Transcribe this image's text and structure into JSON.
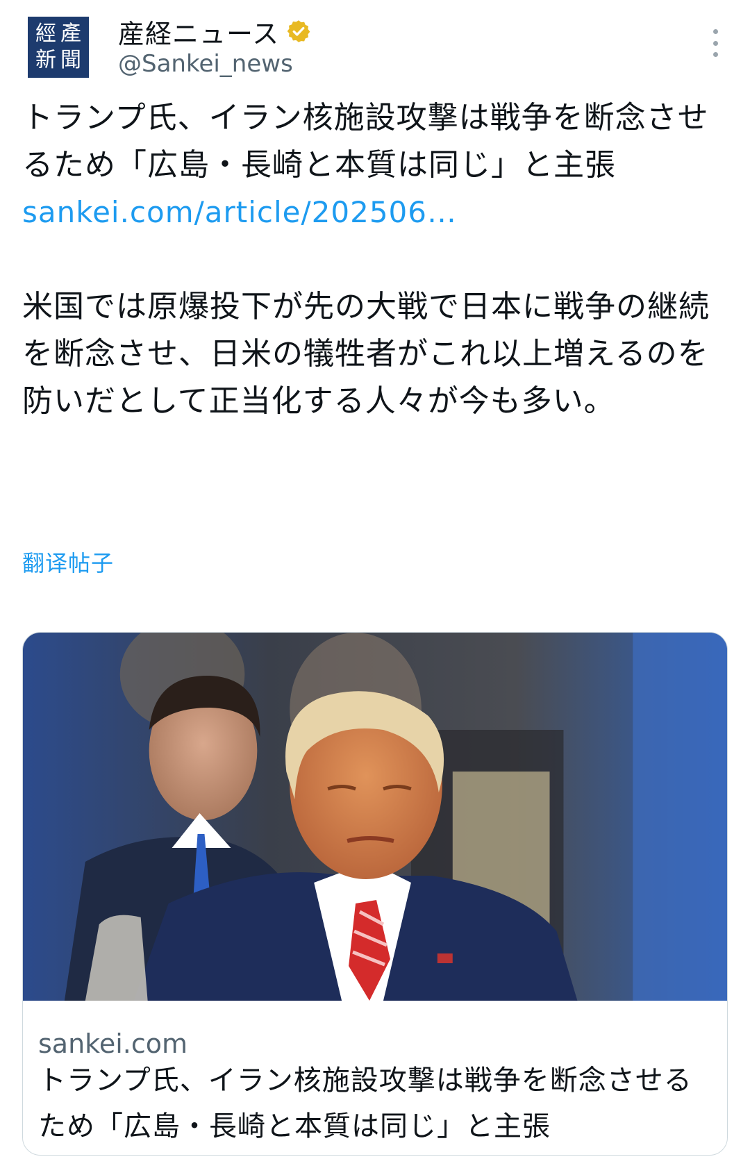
{
  "account": {
    "logo_chars": [
      "產",
      "經",
      "新",
      "聞"
    ],
    "display_name": "産経ニュース",
    "handle": "@Sankei_news",
    "verified": true,
    "verified_icon": "gold-verified-badge-icon",
    "menu_icon": "more-vertical-icon"
  },
  "tweet": {
    "headline": "トランプ氏、イラン核施設攻撃は戦争を断念させるため「広島・長崎と本質は同じ」と主張",
    "link_text": "sankei.com/article/202506…",
    "body": "米国では原爆投下が先の大戦で日本に戦争の継続を断念させ、日米の犠牲者がこれ以上増えるのを防いだとして正当化する人々が今も多い。",
    "translate_label": "翻译帖子"
  },
  "card": {
    "domain": "sankei.com",
    "title": "トランプ氏、イラン核施設攻撃は戦争を断念させるため「広島・長崎と本質は同じ」と主張"
  },
  "colors": {
    "link": "#1d9bf0",
    "secondary_text": "#536471",
    "logo_bg": "#1d3b6e",
    "verified_gold": "#e8b923"
  }
}
